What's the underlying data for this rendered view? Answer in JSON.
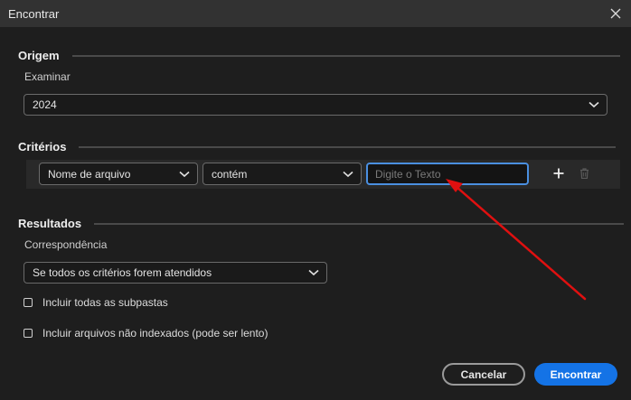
{
  "window": {
    "title": "Encontrar"
  },
  "origin": {
    "heading": "Origem",
    "browse_label": "Examinar",
    "browse_value": "2024"
  },
  "criteria": {
    "heading": "Critérios",
    "field_value": "Nome de arquivo",
    "operator_value": "contém",
    "text_placeholder": "Digite o Texto",
    "text_value": ""
  },
  "results": {
    "heading": "Resultados",
    "match_label": "Correspondência",
    "match_value": "Se todos os critérios forem atendidos",
    "checkboxes": [
      {
        "label": "Incluir todas as subpastas",
        "checked": false
      },
      {
        "label": "Incluir arquivos não indexados (pode ser lento)",
        "checked": false
      }
    ]
  },
  "buttons": {
    "cancel": "Cancelar",
    "find": "Encontrar"
  },
  "icons": [
    "close-icon",
    "chevron-down-icon",
    "plus-icon",
    "trash-icon",
    "annotation-arrow"
  ],
  "colors": {
    "accent": "#1473e6",
    "focus": "#4a8fe0",
    "annotation": "#e01010",
    "background": "#1e1e1e"
  }
}
